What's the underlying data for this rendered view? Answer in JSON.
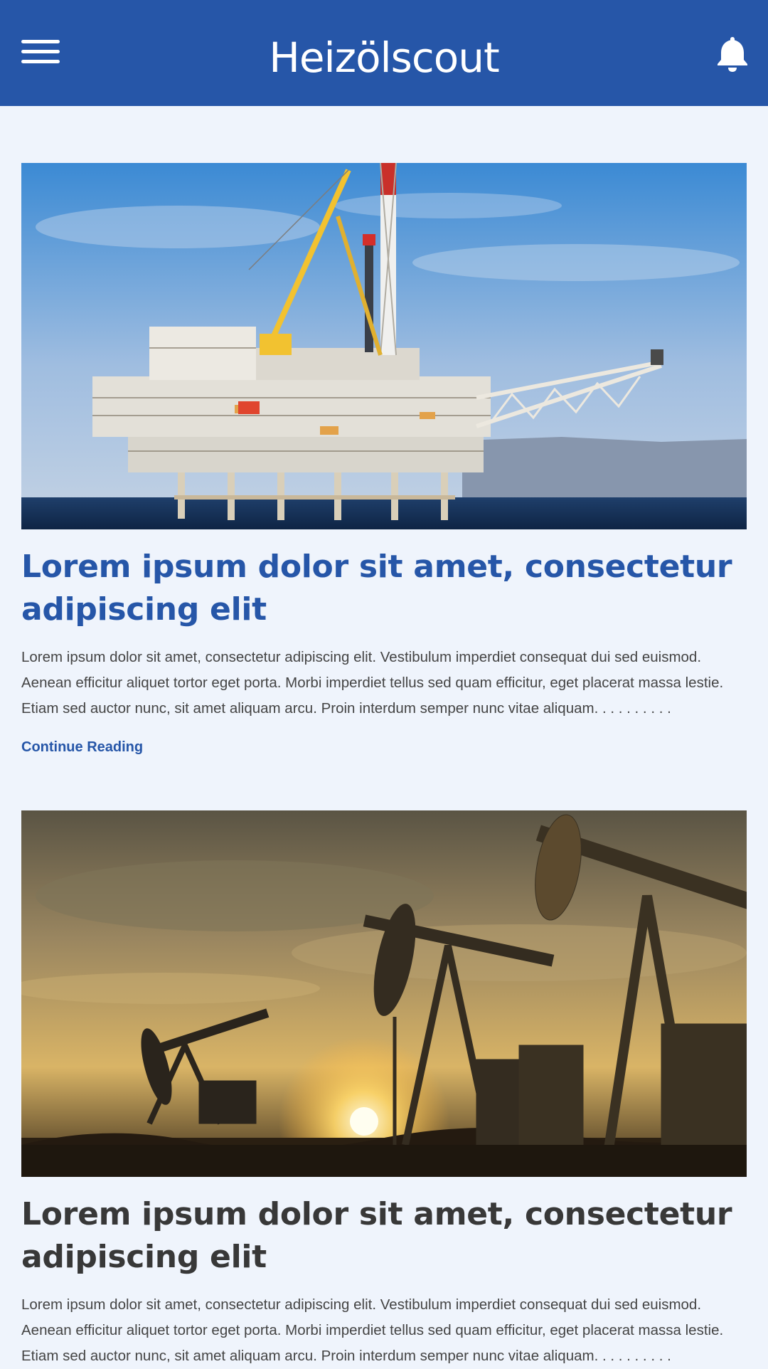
{
  "header": {
    "logo_text": "Heizölscout",
    "menu_icon": "hamburger-menu-icon",
    "notification_icon": "bell-icon",
    "background_color": "#2656a8"
  },
  "articles": [
    {
      "image": "offshore-oil-platform-photo",
      "title": "Lorem ipsum dolor sit amet, consectetur adipiscing elit",
      "excerpt": "Lorem ipsum dolor sit amet, consectetur adipiscing elit. Vestibulum imperdiet consequat dui sed euismod. Aenean efficitur aliquet tortor eget porta. Morbi imperdiet tellus sed quam efficitur, eget placerat massa lestie. Etiam sed auctor nunc, sit amet aliquam arcu. Proin interdum semper nunc vitae aliquam. . . . . . . . . .",
      "link_label": "Continue Reading"
    },
    {
      "image": "oil-pumpjacks-sunset-photo",
      "title": "Lorem ipsum dolor sit amet, consectetur adipiscing elit",
      "excerpt": "Lorem ipsum dolor sit amet, consectetur adipiscing elit. Vestibulum imperdiet consequat dui sed euismod. Aenean efficitur aliquet tortor eget porta. Morbi imperdiet tellus sed quam efficitur, eget placerat massa lestie. Etiam sed auctor nunc, sit amet aliquam arcu. Proin interdum semper nunc vitae aliquam. . . . . . . . . ."
    }
  ],
  "colors": {
    "accent": "#2656a8",
    "page_background": "#eff4fc",
    "title_dark": "#383838"
  }
}
